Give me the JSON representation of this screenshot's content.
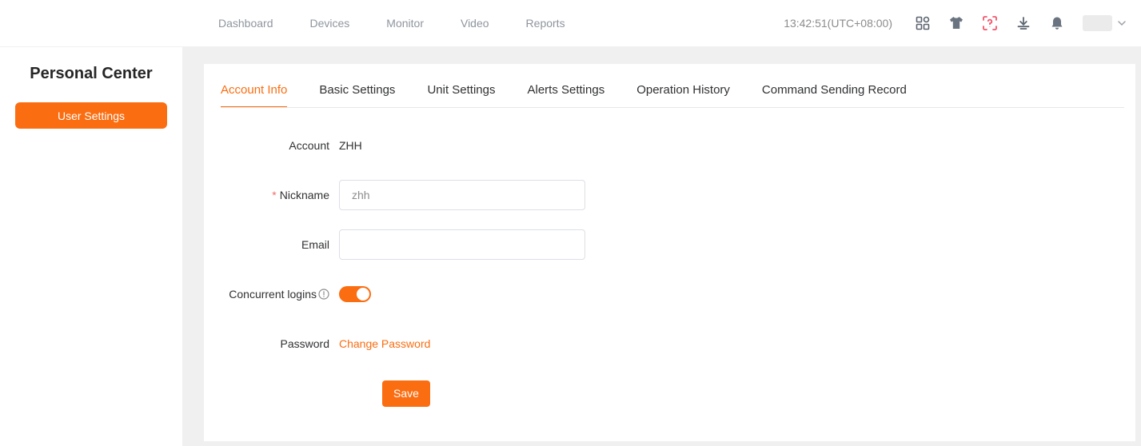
{
  "header": {
    "nav": [
      {
        "label": "Dashboard"
      },
      {
        "label": "Devices"
      },
      {
        "label": "Monitor"
      },
      {
        "label": "Video"
      },
      {
        "label": "Reports"
      }
    ],
    "time": "13:42:51(UTC+08:00)",
    "icons": [
      "grid-icon",
      "tshirt-icon",
      "scan-question-icon",
      "download-icon",
      "bell-icon",
      "chevron-down-icon"
    ]
  },
  "sidebar": {
    "title": "Personal Center",
    "user_settings_label": "User Settings"
  },
  "tabs": [
    {
      "label": "Account Info",
      "active": true
    },
    {
      "label": "Basic Settings",
      "active": false
    },
    {
      "label": "Unit Settings",
      "active": false
    },
    {
      "label": "Alerts Settings",
      "active": false
    },
    {
      "label": "Operation History",
      "active": false
    },
    {
      "label": "Command Sending Record",
      "active": false
    }
  ],
  "form": {
    "account_label": "Account",
    "account_value": "ZHH",
    "nickname_label": "Nickname",
    "nickname_value": "zhh",
    "email_label": "Email",
    "email_value": "",
    "concurrent_label": "Concurrent logins",
    "concurrent_on": true,
    "password_label": "Password",
    "change_password_label": "Change Password",
    "save_label": "Save"
  },
  "colors": {
    "accent": "#fb6d11",
    "danger_icon": "#f2566b",
    "required_star": "#f56c6c"
  }
}
